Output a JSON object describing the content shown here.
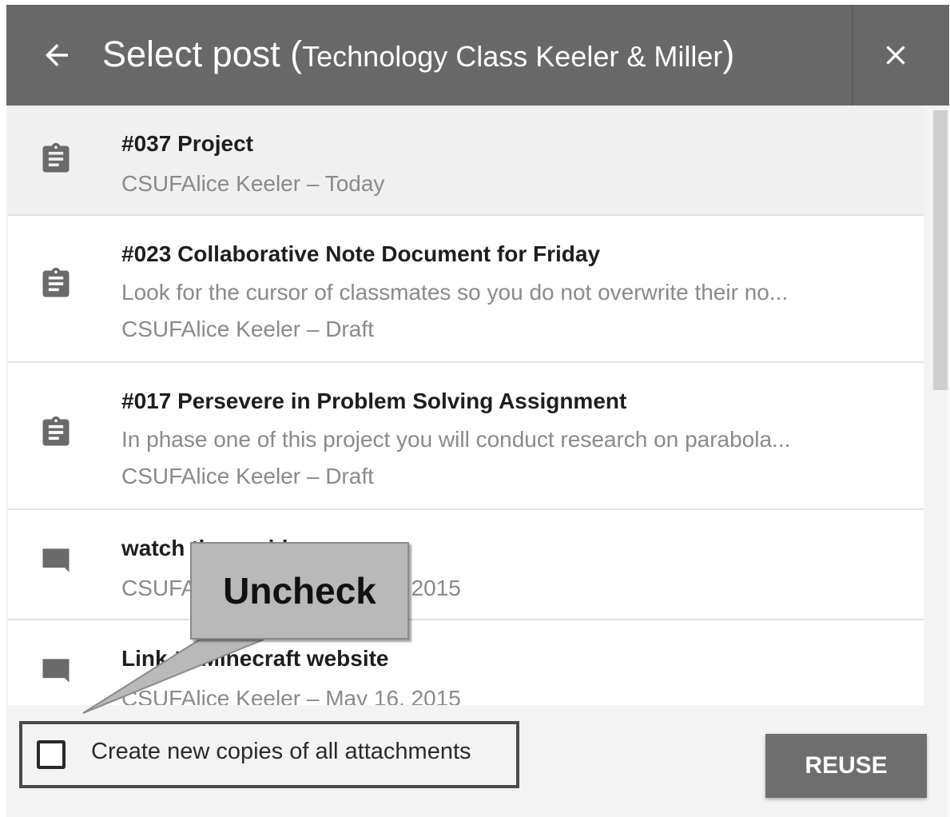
{
  "header": {
    "back_icon": "arrow-left-icon",
    "title": "Select post (",
    "course": "Technology Class Keeler & Miller",
    "title_end": ")",
    "close_icon": "close-icon"
  },
  "posts": [
    {
      "icon": "assignment-icon",
      "title": "#037 Project",
      "description": "",
      "meta": "CSUFAlice Keeler – Today",
      "selected": true
    },
    {
      "icon": "assignment-icon",
      "title": "#023 Collaborative Note Document for Friday",
      "description": "Look for the cursor of classmates so you do not overwrite their no...",
      "meta": "CSUFAlice Keeler – Draft"
    },
    {
      "icon": "assignment-icon",
      "title": "#017 Persevere in Problem Solving Assignment",
      "description": "In phase one of this project you will conduct research on parabola...",
      "meta": "CSUFAlice Keeler – Draft"
    },
    {
      "icon": "comment-icon",
      "title": "watch these videos",
      "description": "",
      "meta": "CSUFAlice Keeler – May 16, 2015"
    },
    {
      "icon": "comment-icon",
      "title": "Link to Minecraft website",
      "description": "",
      "meta": "CSUFAlice Keeler – May 16, 2015"
    }
  ],
  "footer": {
    "checkbox_label": "Create new copies of all attachments",
    "checkbox_checked": false,
    "reuse_label": "REUSE"
  },
  "callout": {
    "text": "Uncheck"
  },
  "colors": {
    "header_bg": "#686868",
    "dialog_bg": "#f3f3f3",
    "button_bg": "#6e6e6e",
    "callout_bg": "#b9b9b9"
  }
}
